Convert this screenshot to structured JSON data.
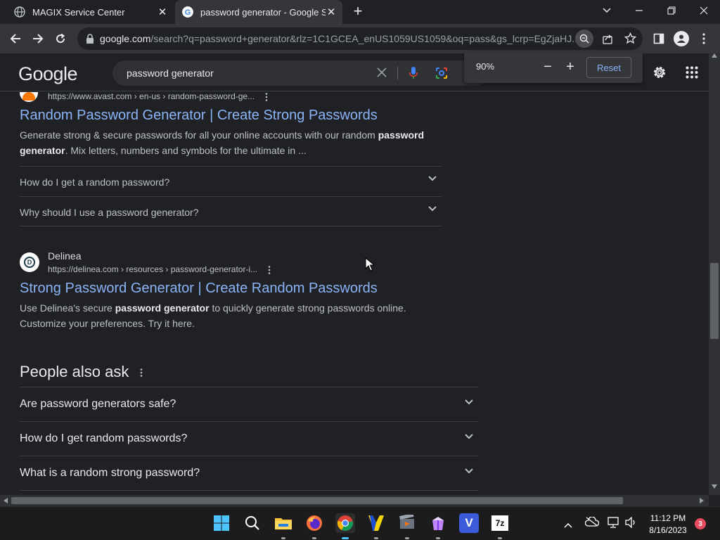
{
  "browser": {
    "tabs": [
      {
        "title": "MAGIX Service Center"
      },
      {
        "title": "password generator - Google Search"
      }
    ],
    "new_tab_symbol": "+",
    "address": {
      "domain": "google.com",
      "path": "/search?q=password+generator&rlz=1C1GCEA_enUS1059US1059&oq=pass&gs_lcrp=EgZjaHJ..."
    }
  },
  "zoom_popup": {
    "level": "90%",
    "reset_label": "Reset",
    "minus": "−",
    "plus": "+"
  },
  "google": {
    "logo": "Google",
    "query": "password generator",
    "colors": {
      "link": "#8ab4f8",
      "background": "#202124"
    }
  },
  "results": [
    {
      "url": "https://www.avast.com › en-us › random-password-ge...",
      "title": "Random Password Generator | Create Strong Passwords",
      "snippet_parts": [
        "Generate strong & secure passwords for all your online accounts with our random ",
        "password generator",
        ". Mix letters, numbers and symbols for the ultimate in ..."
      ],
      "faqs": [
        "How do I get a random password?",
        "Why should I use a password generator?"
      ]
    },
    {
      "site_name": "Delinea",
      "url": "https://delinea.com › resources › password-generator-i...",
      "title": "Strong Password Generator | Create Random Passwords",
      "snippet_parts": [
        "Use Delinea's secure ",
        "password generator",
        " to quickly generate strong passwords online.",
        "Customize your preferences. Try it here."
      ]
    }
  ],
  "people_also_ask": {
    "heading": "People also ask",
    "questions": [
      "Are password generators safe?",
      "How do I get random passwords?",
      "What is a random strong password?"
    ]
  },
  "taskbar": {
    "time": "11:12 PM",
    "date": "8/16/2023",
    "notification_count": "3",
    "sevenzip_label": "7z",
    "v_label": "V"
  }
}
